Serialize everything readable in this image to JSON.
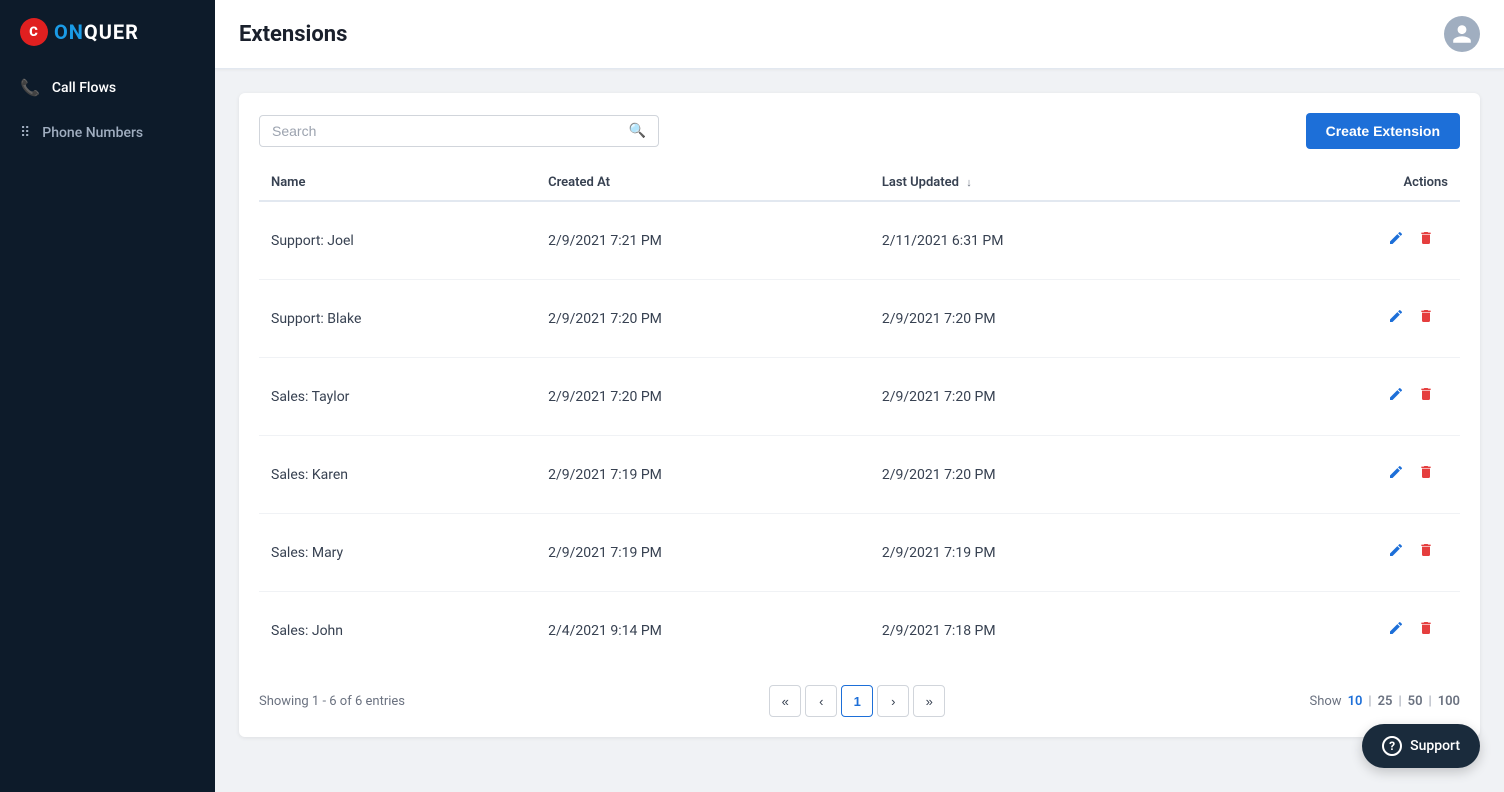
{
  "app": {
    "title": "CONQUER",
    "logo_letter": "C"
  },
  "sidebar": {
    "items": [
      {
        "id": "call-flows",
        "label": "Call Flows",
        "icon": "phone",
        "active": true
      },
      {
        "id": "phone-numbers",
        "label": "Phone Numbers",
        "icon": "grid",
        "active": false
      }
    ]
  },
  "page": {
    "title": "Extensions"
  },
  "toolbar": {
    "search_placeholder": "Search",
    "create_button_label": "Create Extension"
  },
  "table": {
    "columns": [
      {
        "id": "name",
        "label": "Name"
      },
      {
        "id": "created_at",
        "label": "Created At"
      },
      {
        "id": "last_updated",
        "label": "Last Updated",
        "sortable": true
      },
      {
        "id": "actions",
        "label": "Actions"
      }
    ],
    "rows": [
      {
        "name": "Support: Joel",
        "created_at": "2/9/2021 7:21 PM",
        "last_updated": "2/11/2021 6:31 PM"
      },
      {
        "name": "Support: Blake",
        "created_at": "2/9/2021 7:20 PM",
        "last_updated": "2/9/2021 7:20 PM"
      },
      {
        "name": "Sales: Taylor",
        "created_at": "2/9/2021 7:20 PM",
        "last_updated": "2/9/2021 7:20 PM"
      },
      {
        "name": "Sales: Karen",
        "created_at": "2/9/2021 7:19 PM",
        "last_updated": "2/9/2021 7:20 PM"
      },
      {
        "name": "Sales: Mary",
        "created_at": "2/9/2021 7:19 PM",
        "last_updated": "2/9/2021 7:19 PM"
      },
      {
        "name": "Sales: John",
        "created_at": "2/4/2021 9:14 PM",
        "last_updated": "2/9/2021 7:18 PM"
      }
    ]
  },
  "pagination": {
    "showing_text": "Showing 1 - 6 of 6 entries",
    "current_page": 1,
    "show_label": "Show",
    "show_options": [
      "10",
      "25",
      "50",
      "100"
    ],
    "active_show": "10"
  },
  "support": {
    "label": "Support"
  }
}
